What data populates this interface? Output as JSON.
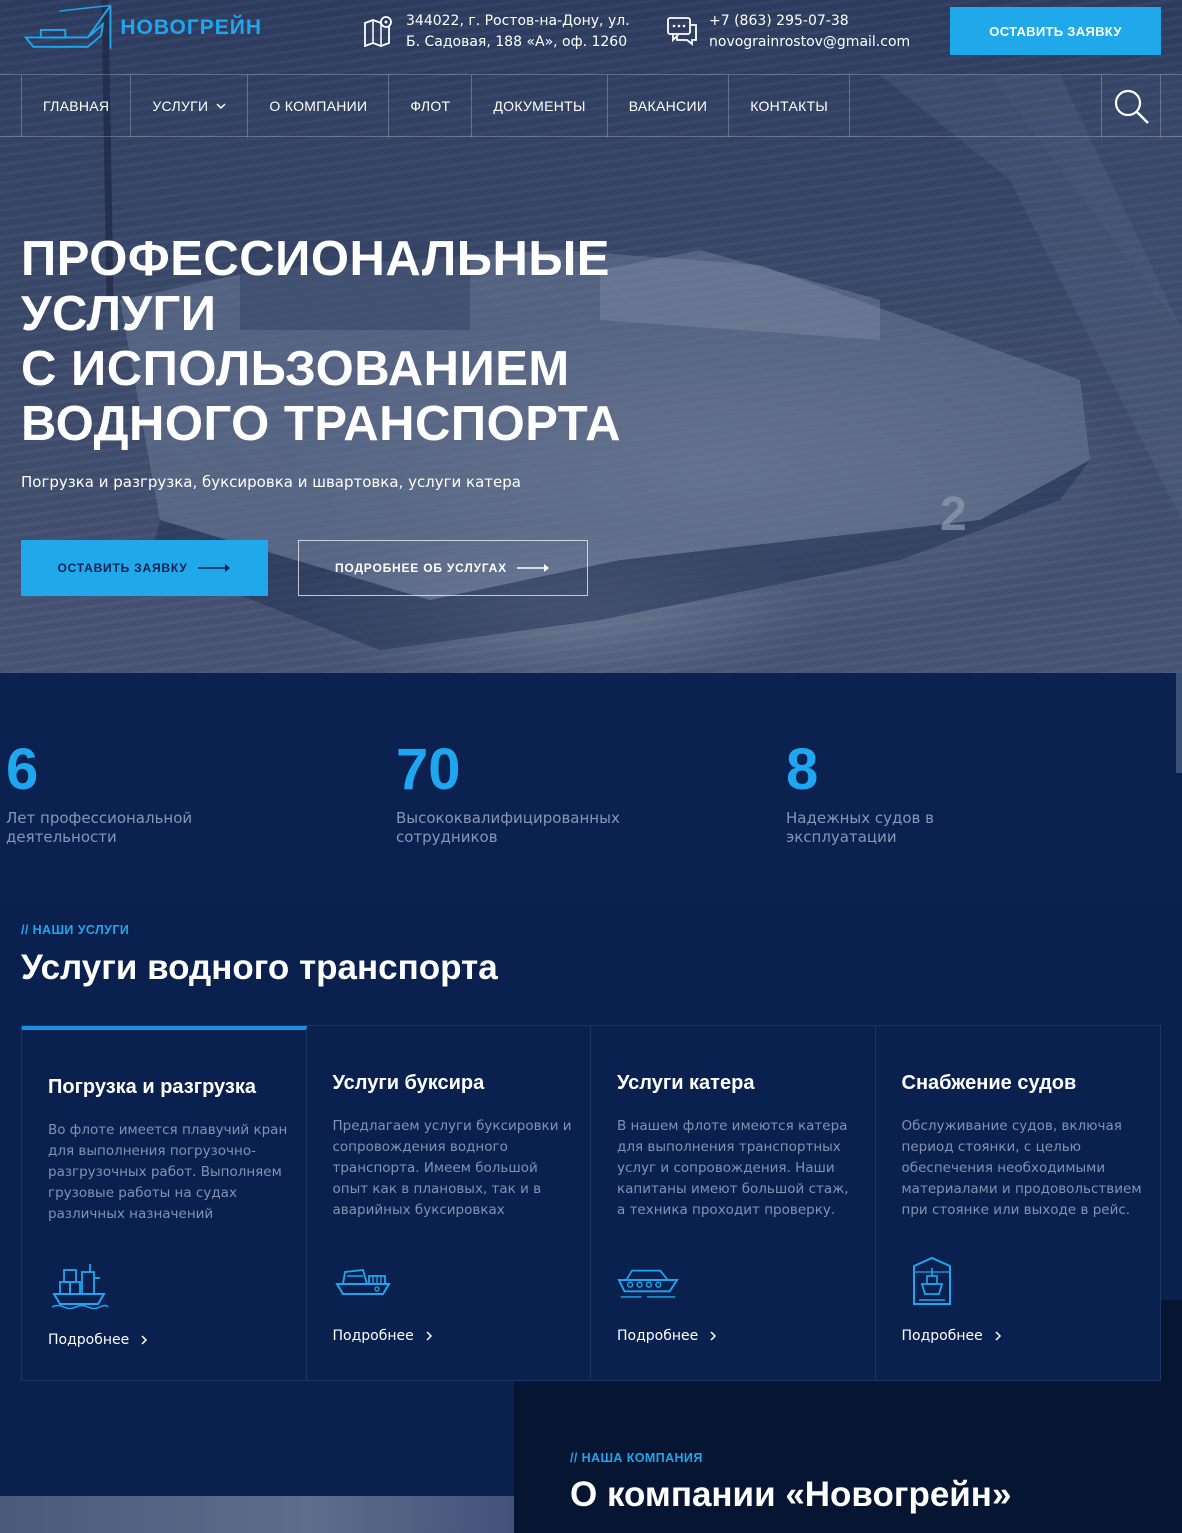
{
  "header": {
    "logo_text": "НОВОГРЕЙН",
    "address_line1": "344022, г. Ростов-на-Дону, ул.",
    "address_line2": "Б. Садовая, 188 «А», оф. 1260",
    "phone": "+7 (863) 295-07-38",
    "email": "novograinrostov@gmail.com",
    "cta_label": "ОСТАВИТЬ ЗАЯВКУ"
  },
  "nav": {
    "items": [
      {
        "label": "ГЛАВНАЯ"
      },
      {
        "label": "УСЛУГИ"
      },
      {
        "label": "О КОМПАНИИ"
      },
      {
        "label": "ФЛОТ"
      },
      {
        "label": "ДОКУМЕНТЫ"
      },
      {
        "label": "ВАКАНСИИ"
      },
      {
        "label": "КОНТАКТЫ"
      }
    ]
  },
  "hero": {
    "title_lines": [
      "ПРОФЕССИОНАЛЬНЫЕ",
      "УСЛУГИ",
      "С ИСПОЛЬЗОВАНИЕМ",
      "ВОДНОГО ТРАНСПОРТА"
    ],
    "subtitle": "Погрузка и разгрузка, буксировка и швартовка, услуги катера",
    "primary_button": "ОСТАВИТЬ ЗАЯВКУ",
    "secondary_button": "ПОДРОБНЕЕ ОБ УСЛУГАХ"
  },
  "stats": [
    {
      "value": "6",
      "label": "Лет профессиональной деятельности"
    },
    {
      "value": "70",
      "label": "Высококвалифицированных сотрудников"
    },
    {
      "value": "8",
      "label": "Надежных судов в эксплуатации"
    }
  ],
  "services": {
    "kicker": "// НАШИ УСЛУГИ",
    "title": "Услуги водного транспорта",
    "cards": [
      {
        "title": "Погрузка и разгрузка",
        "text": "Во флоте имеется плавучий кран для выполнения погрузочно-разгрузочных работ. Выполняем грузовые работы на судах различных назначений",
        "link": "Подробнее",
        "icon": "cargo-ship-icon"
      },
      {
        "title": "Услуги буксира",
        "text": "Предлагаем услуги буксировки и сопровождения водного транспорта. Имеем большой опыт как в плановых, так и в аварийных буксировках",
        "link": "Подробнее",
        "icon": "tugboat-icon"
      },
      {
        "title": "Услуги катера",
        "text": "В нашем флоте имеются катера для выполнения транспортных услуг и сопровождения. Наши капитаны имеют большой стаж, а техника проходит проверку.",
        "link": "Подробнее",
        "icon": "boat-icon"
      },
      {
        "title": "Снабжение судов",
        "text": "Обслуживание судов, включая период стоянки, с целью обеспечения необходимыми материалами и продовольствием при стоянке или выходе в рейс.",
        "link": "Подробнее",
        "icon": "ship-supply-icon"
      }
    ]
  },
  "about": {
    "kicker": "// НАША КОМПАНИЯ",
    "title": "О компании «Новогрейн»"
  },
  "colors": {
    "accent": "#1fa9ea",
    "background": "#0a2150",
    "text_muted": "#8392ae"
  }
}
